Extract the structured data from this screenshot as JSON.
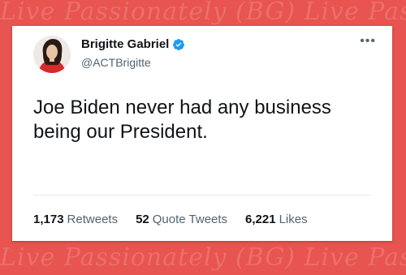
{
  "watermark": {
    "text": "Live Passionately (BG) Live Passionately (BG)"
  },
  "tweet": {
    "author": {
      "name": "Brigitte Gabriel",
      "handle": "@ACTBrigitte",
      "verified": true,
      "avatar_icon": "profile-photo"
    },
    "more_icon": "ellipsis-icon",
    "text": "Joe Biden never had any business being our President.",
    "stats": {
      "retweets_count": "1,173",
      "retweets_label": "Retweets",
      "quotes_count": "52",
      "quotes_label": "Quote Tweets",
      "likes_count": "6,221",
      "likes_label": "Likes"
    }
  },
  "colors": {
    "background": "#e8544f",
    "verified": "#1d9bf0",
    "text_primary": "#0f1419",
    "text_secondary": "#536471"
  }
}
